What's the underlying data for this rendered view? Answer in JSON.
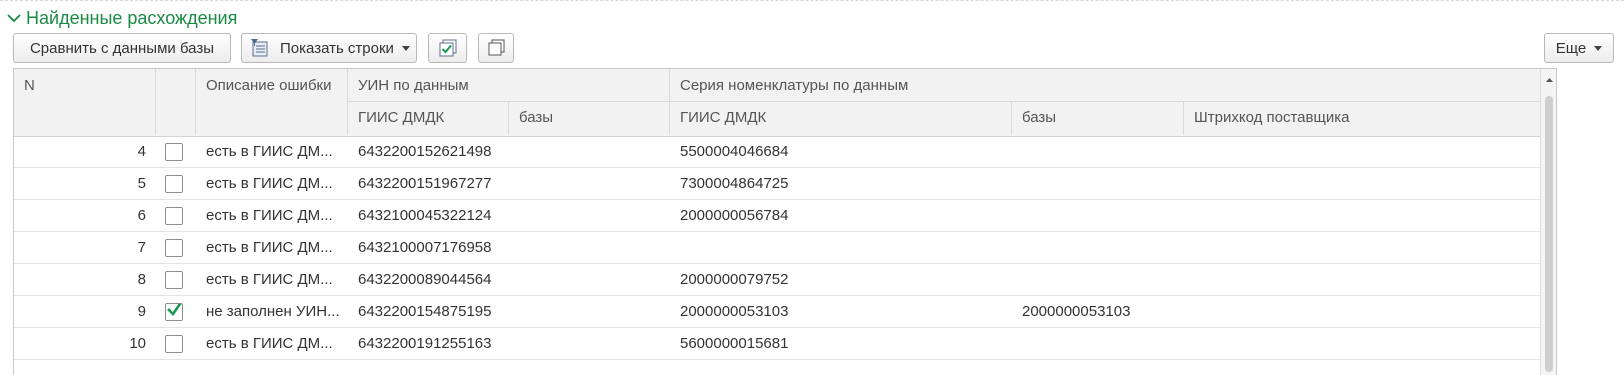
{
  "group": {
    "title": "Найденные расхождения",
    "expanded_icon": "chevron-down-icon"
  },
  "toolbar": {
    "compare_label": "Сравнить с данными базы",
    "show_rows_label": "Показать строки",
    "more_label": "Еще"
  },
  "table": {
    "headers": {
      "n": "N",
      "description": "Описание ошибки",
      "uin_group": "УИН по данным",
      "series_group": "Серия номенклатуры по данным",
      "uin_giis": "ГИИС ДМДК",
      "uin_base": "базы",
      "series_giis": "ГИИС ДМДК",
      "series_base": "базы",
      "supplier_barcode": "Штрихкод поставщика"
    },
    "rows": [
      {
        "n": "4",
        "checked": false,
        "description": "есть в ГИИС ДМ...",
        "uin_giis": "6432200152621498",
        "series_giis": "5500004046684",
        "series_base": ""
      },
      {
        "n": "5",
        "checked": false,
        "description": "есть в ГИИС ДМ...",
        "uin_giis": "6432200151967277",
        "series_giis": "7300004864725",
        "series_base": ""
      },
      {
        "n": "6",
        "checked": false,
        "description": "есть в ГИИС ДМ...",
        "uin_giis": "6432100045322124",
        "series_giis": "2000000056784",
        "series_base": ""
      },
      {
        "n": "7",
        "checked": false,
        "description": "есть в ГИИС ДМ...",
        "uin_giis": "6432100007176958",
        "series_giis": "",
        "series_base": ""
      },
      {
        "n": "8",
        "checked": false,
        "description": "есть в ГИИС ДМ...",
        "uin_giis": "6432200089044564",
        "series_giis": "2000000079752",
        "series_base": ""
      },
      {
        "n": "9",
        "checked": true,
        "description": "не заполнен УИН...",
        "uin_giis": "6432200154875195",
        "series_giis": "2000000053103",
        "series_base": "2000000053103"
      },
      {
        "n": "10",
        "checked": false,
        "description": "есть в ГИИС ДМ...",
        "uin_giis": "6432200191255163",
        "series_giis": "5600000015681",
        "series_base": ""
      }
    ]
  },
  "colors": {
    "accent_green": "#1a8a44",
    "header_bg": "#f2f2f2",
    "check_green": "#1a9a50"
  }
}
